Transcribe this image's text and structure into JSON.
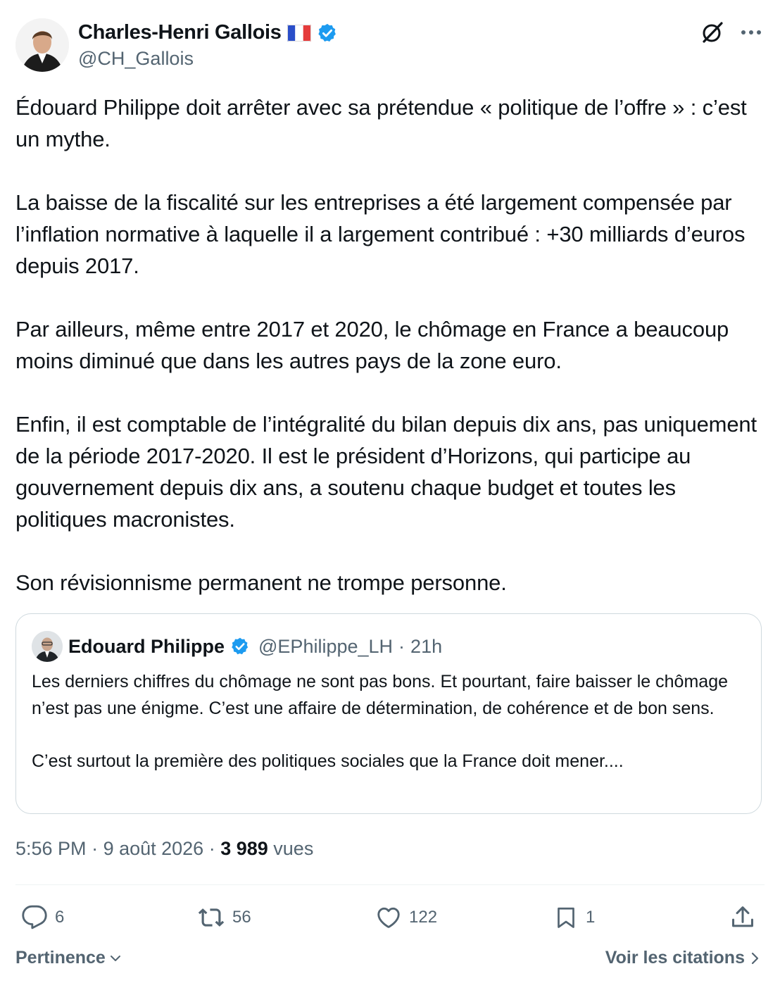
{
  "author": {
    "name": "Charles-Henri Gallois",
    "flag": "🇫🇷",
    "handle": "@CH_Gallois"
  },
  "icons": {
    "grok": "grok-icon",
    "more": "more-icon",
    "verified_color": "#1d9bf0"
  },
  "post": {
    "text": "Édouard Philippe doit arrêter avec sa prétendue « politique de l’offre » : c’est un mythe.\n\nLa baisse de la fiscalité sur les entreprises a été largement compensée par l’inflation normative à laquelle il a largement contribué : +30 milliards d’euros depuis 2017.\n\nPar ailleurs, même entre 2017 et 2020, le chômage en France a beaucoup moins diminué que dans les autres pays de la zone euro.\n\nEnfin, il est comptable de l’intégralité du bilan depuis dix ans, pas uniquement de la période 2017-2020. Il est le président d’Horizons, qui participe au gouvernement depuis dix ans, a soutenu chaque budget et toutes les politiques macronistes.\n\nSon révisionnisme permanent ne trompe personne."
  },
  "quote": {
    "name": "Edouard Philippe",
    "handle": "@EPhilippe_LH",
    "separator": "·",
    "time": "21h",
    "text": "Les derniers chiffres du chômage ne sont pas bons. Et pourtant, faire baisser le chômage n’est pas une énigme. C’est une affaire de détermination, de cohérence et de bon sens.\n\nC’est surtout la première des politiques sociales que la France doit mener...."
  },
  "meta": {
    "time": "5:56 PM",
    "sep1": " · ",
    "date": "9 août 2026",
    "sep2": " · ",
    "views": "3 989",
    "views_label": " vues"
  },
  "actions": {
    "replies": "6",
    "reposts": "56",
    "likes": "122",
    "bookmarks": "1"
  },
  "footer": {
    "sort_label": "Pertinence",
    "quotes_link": "Voir les citations"
  }
}
